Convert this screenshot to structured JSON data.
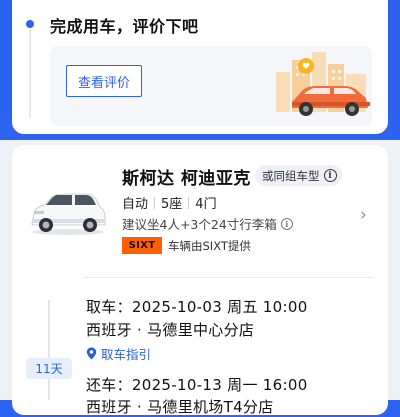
{
  "status": {
    "title": "完成用车，评价下吧",
    "review_button": "查看评价"
  },
  "car": {
    "name": "斯柯达 柯迪亚克",
    "similar_tag": "或同组车型",
    "specs": [
      "自动",
      "5座",
      "4门"
    ],
    "luggage": "建议坐4人+3个24寸行李箱",
    "provider_logo": "SIXT",
    "provider_text": "车辆由SIXT提供"
  },
  "rental": {
    "days": "11天",
    "pickup": {
      "datetime": "取车：2025-10-03 周五 10:00",
      "location": "西班牙 · 马德里中心分店",
      "guide": "取车指引"
    },
    "return": {
      "datetime": "还车：2025-10-13 周一 16:00",
      "location": "西班牙 · 马德里机场T4分店"
    }
  },
  "colors": {
    "primary": "#2a63f0",
    "header_bg": "#2c63f0",
    "sixt_orange": "#ff5f00",
    "car_orange": "#f26b3a"
  }
}
